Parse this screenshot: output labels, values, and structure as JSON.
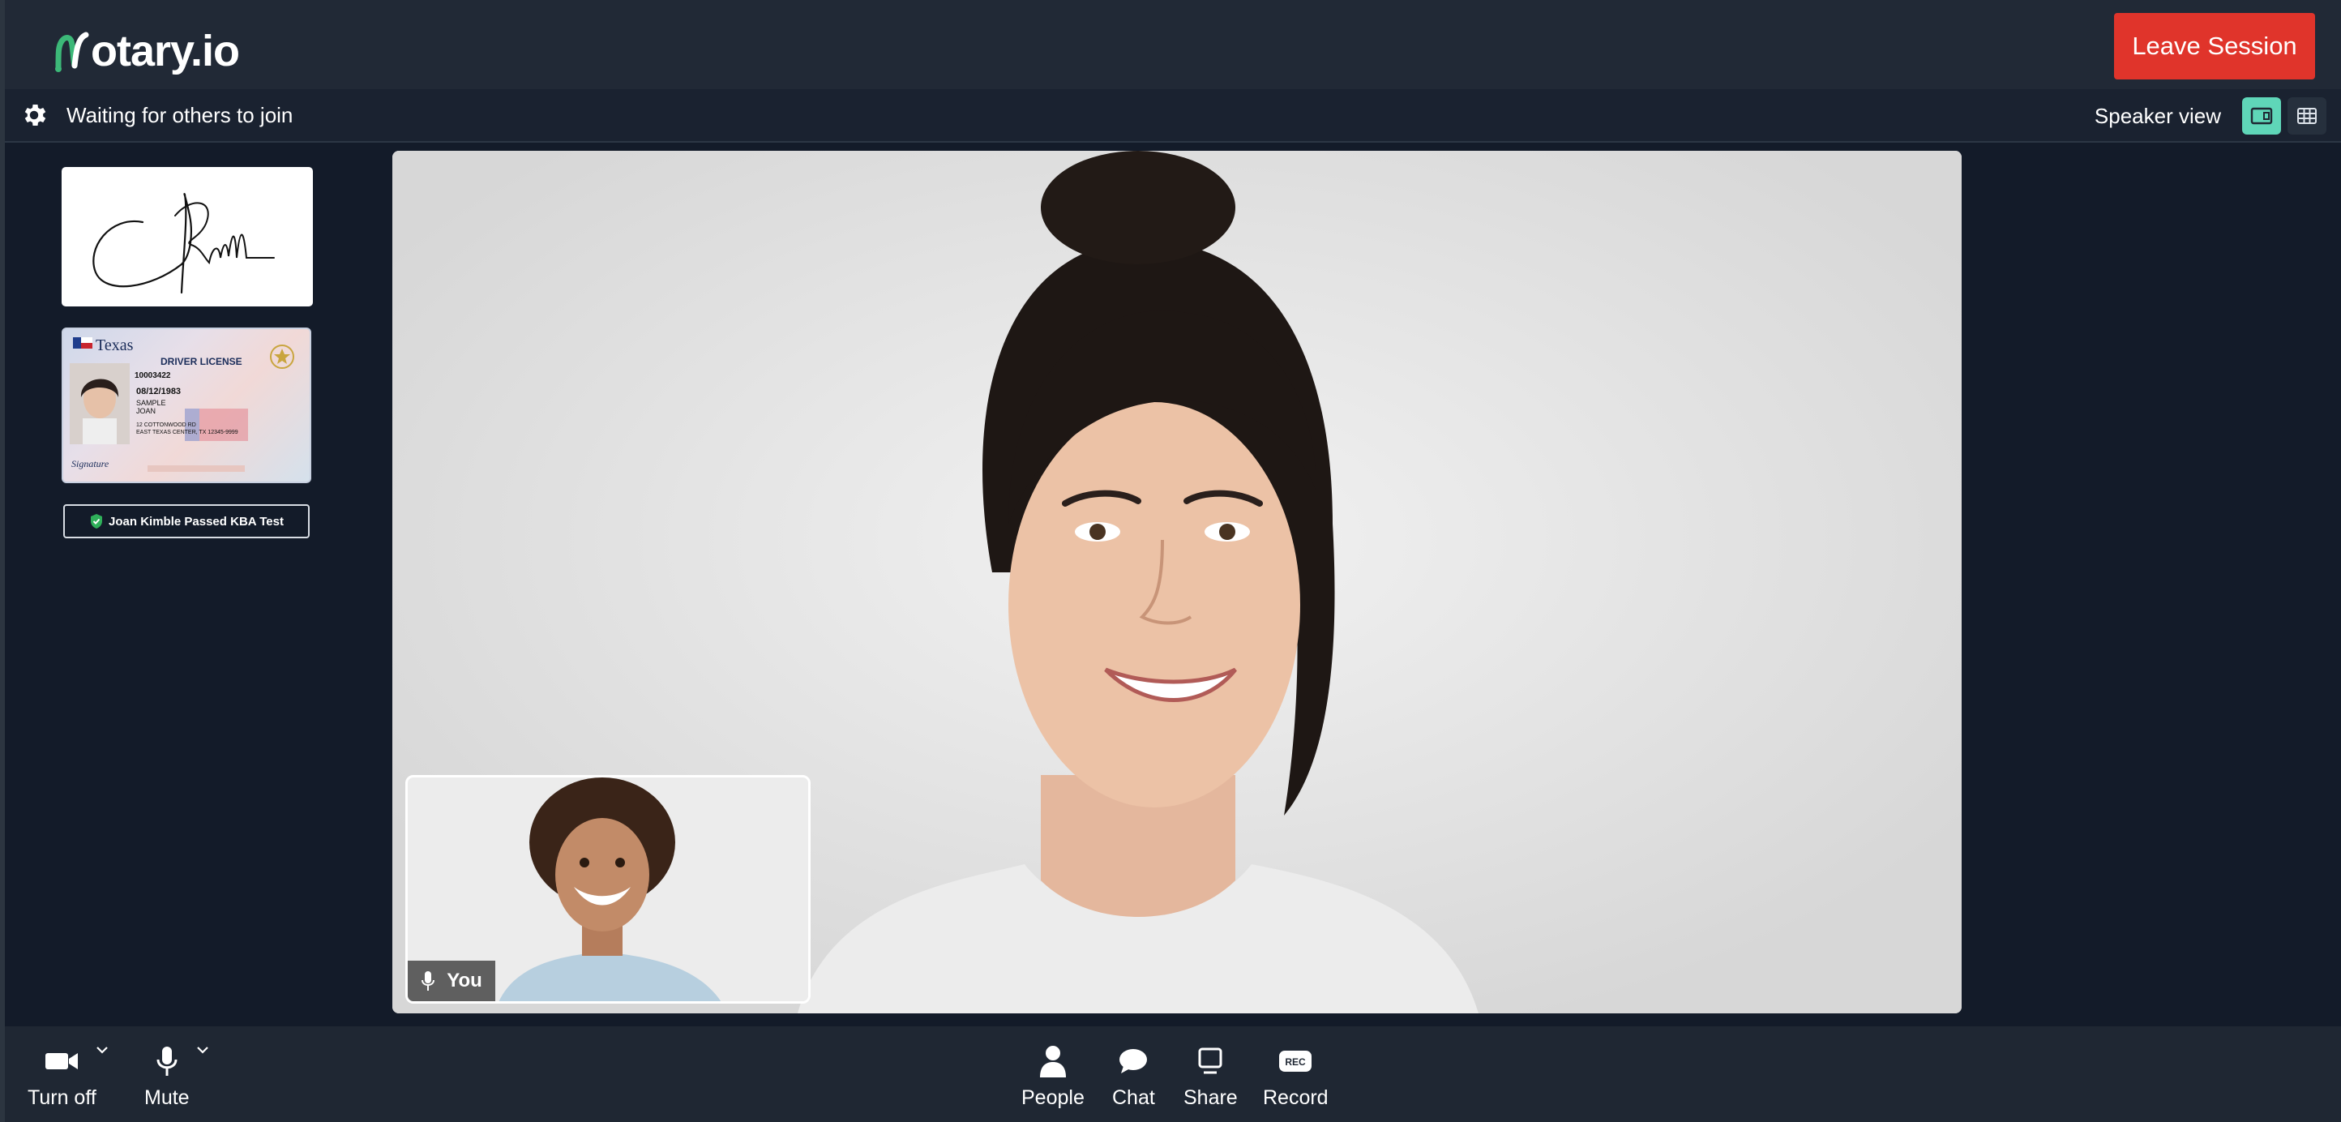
{
  "header": {
    "logo_text": "otary.io",
    "leave_label": "Leave Session"
  },
  "status": {
    "message": "Waiting for others to join",
    "view_label": "Speaker view"
  },
  "sidebar": {
    "id_card": {
      "state": "Texas",
      "title": "DRIVER LICENSE",
      "number": "10003422",
      "dob": "08/12/1983",
      "surname": "SAMPLE",
      "given": "JOAN",
      "address_1": "12 COTTONWOOD RD",
      "address_2": "EAST TEXAS CENTER, TX 12345-9999",
      "signature": "Signature"
    },
    "kba_label": "Joan Kimble Passed KBA Test"
  },
  "video": {
    "self_label": "You"
  },
  "toolbar": {
    "camera_label": "Turn off",
    "mute_label": "Mute",
    "people_label": "People",
    "chat_label": "Chat",
    "share_label": "Share",
    "record_label": "Record",
    "record_badge": "REC"
  },
  "colors": {
    "accent": "#5fd6b8",
    "danger": "#e0342b",
    "logo_green": "#3cb878",
    "background": "#131b29"
  }
}
